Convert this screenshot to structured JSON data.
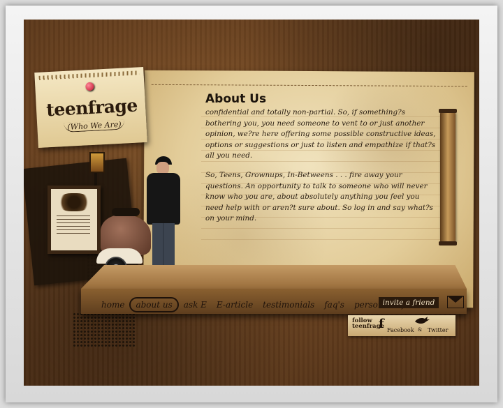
{
  "brand": {
    "name": "teenfrage",
    "tagline": "(Who We Are)"
  },
  "page": {
    "title": "About Us",
    "paragraphs": [
      "confidential and totally non-partial.  So, if something?s bothering you, you need someone to vent to or just another opinion, we?re here offering some possible constructive ideas, options or suggestions or just to listen  and empathize if that?s all you need.",
      "So, Teens, Grownups, In-Betweens . . . fire away your questions.   An opportunity to talk to someone who will never know who you are, about absolutely anything you feel you need help with or aren?t sure about.  So log in and say what?s on your mind."
    ]
  },
  "nav": {
    "items": [
      {
        "label": "home",
        "active": false
      },
      {
        "label": "about us",
        "active": true
      },
      {
        "label": "ask E",
        "active": false
      },
      {
        "label": "E-article",
        "active": false
      },
      {
        "label": "testimonials",
        "active": false
      },
      {
        "label": "faq's",
        "active": false
      },
      {
        "label": "personal info",
        "active": false
      }
    ],
    "invite_label": "invite a friend"
  },
  "follow": {
    "label_line1": "follow",
    "label_line2": "teenfrage",
    "facebook_icon": "f",
    "facebook_label": "Facebook",
    "amp": "&",
    "twitter_label": "Twitter"
  },
  "icons": [
    "pushpin-icon",
    "mail-icon",
    "facebook-icon",
    "twitter-bird-icon",
    "lamp-icon"
  ],
  "colors": {
    "background": "#5a3618",
    "parchment": "#e8d4a6",
    "ink": "#1e120a",
    "pin": "#c0102a"
  }
}
